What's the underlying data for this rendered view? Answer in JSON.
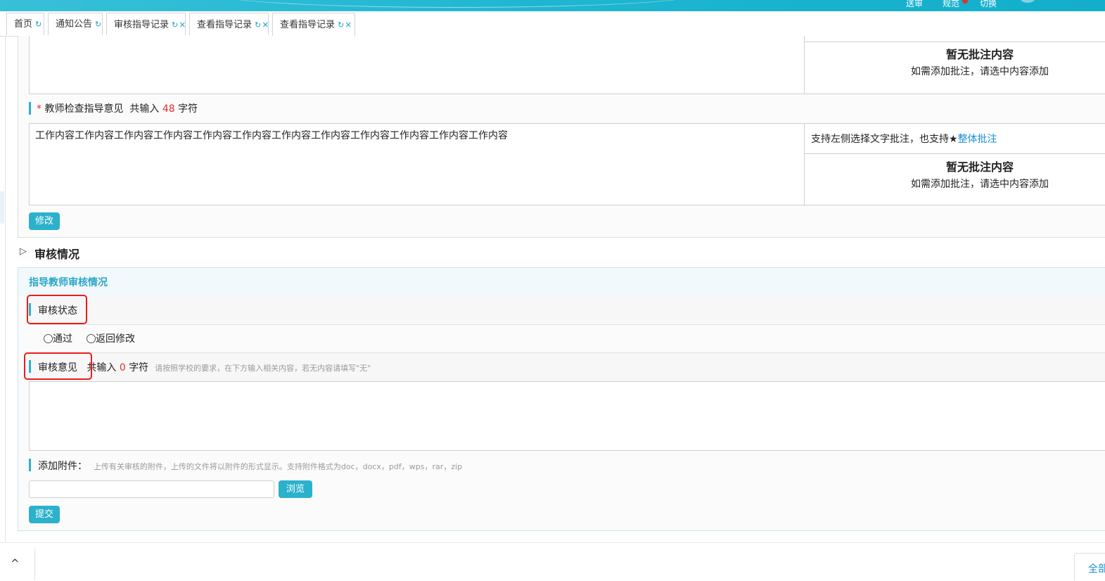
{
  "topbar": {
    "items": [
      "送审",
      "规范",
      "切换"
    ],
    "badge_color": "#e0312d"
  },
  "tabs": [
    {
      "label": "首页",
      "closable": false
    },
    {
      "label": "通知公告",
      "closable": false
    },
    {
      "label": "审核指导记录",
      "closable": true
    },
    {
      "label": "查看指导记录",
      "closable": true
    },
    {
      "label": "查看指导记录",
      "closable": true,
      "active": true
    }
  ],
  "tab_icons": {
    "refresh": "↻",
    "close": "×"
  },
  "upper_section": {
    "annotation1": {
      "title": "暂无批注内容",
      "subtitle": "如需添加批注，请选中内容添加"
    },
    "teacher_opinion": {
      "required_mark": "*",
      "label": "教师检查指导意见",
      "count_prefix": "共输入",
      "count": "48",
      "count_suffix": "字符",
      "content": "工作内容工作内容工作内容工作内容工作内容工作内容工作内容工作内容工作内容工作内容工作内容工作内容"
    },
    "annotation2": {
      "hint_prefix": "支持左侧选择文字批注，也支持",
      "star": "★",
      "whole_link": "整体批注",
      "title": "暂无批注内容",
      "subtitle": "如需添加批注，请选中内容添加"
    },
    "modify_button": "修改"
  },
  "review": {
    "toggle_icon": "▷",
    "heading": "审核情况",
    "panel_title": "指导教师审核情况",
    "status_label": "审核状态",
    "options": [
      "通过",
      "返回修改"
    ],
    "opinion_label": "审核意见",
    "count_prefix": "共输入",
    "count": "0",
    "count_suffix": "字符",
    "opinion_hint": "请按照学校的要求，在下方输入相关内容，若无内容请填写\"无\"",
    "attach_label": "添加附件：",
    "attach_hint": "上传有关审核的附件，上传的文件将以附件的形式显示。支持附件格式为doc，docx，pdf，wps，rar，zip",
    "browse_button": "浏览",
    "submit_button": "提交"
  },
  "footer": {
    "scroll_up_icon": "^",
    "right_text": "全部"
  }
}
